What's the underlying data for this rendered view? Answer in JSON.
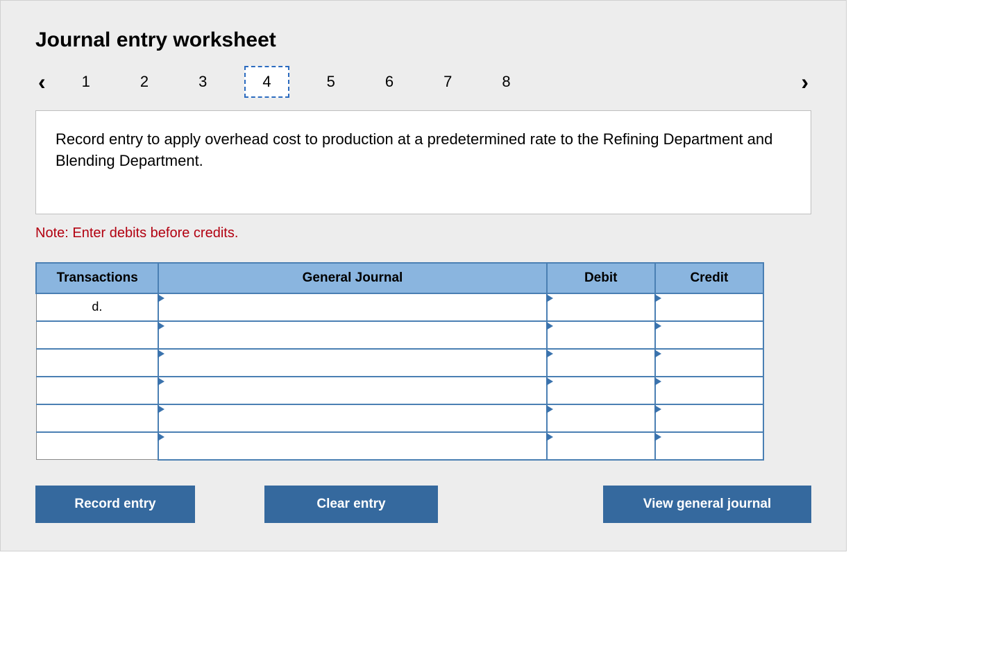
{
  "title": "Journal entry worksheet",
  "nav": {
    "prev_glyph": "‹",
    "next_glyph": "›",
    "tabs": [
      "1",
      "2",
      "3",
      "4",
      "5",
      "6",
      "7",
      "8"
    ],
    "active_index": 3
  },
  "instruction": "Record entry to apply overhead cost to production at a predetermined rate to the Refining Department and Blending Department.",
  "note": "Note: Enter debits before credits.",
  "table": {
    "headers": {
      "transactions": "Transactions",
      "general_journal": "General Journal",
      "debit": "Debit",
      "credit": "Credit"
    },
    "rows": [
      {
        "transaction": "d.",
        "general_journal": "",
        "debit": "",
        "credit": ""
      },
      {
        "transaction": "",
        "general_journal": "",
        "debit": "",
        "credit": ""
      },
      {
        "transaction": "",
        "general_journal": "",
        "debit": "",
        "credit": ""
      },
      {
        "transaction": "",
        "general_journal": "",
        "debit": "",
        "credit": ""
      },
      {
        "transaction": "",
        "general_journal": "",
        "debit": "",
        "credit": ""
      },
      {
        "transaction": "",
        "general_journal": "",
        "debit": "",
        "credit": ""
      }
    ]
  },
  "buttons": {
    "record": "Record entry",
    "clear": "Clear entry",
    "view": "View general journal"
  }
}
